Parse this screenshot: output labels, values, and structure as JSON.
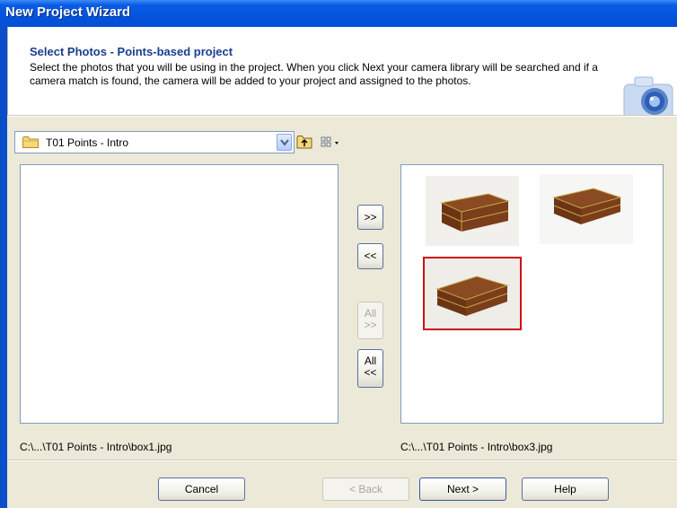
{
  "window": {
    "title": "New Project Wizard"
  },
  "header": {
    "title": "Select Photos - Points-based project",
    "description": "Select the photos that you will be using in the project. When you click Next your camera library will be searched and if a camera match is found, the camera will be added to your project and assigned to the photos.",
    "icon": "camera-icon"
  },
  "folder": {
    "selected": "T01 Points - Intro",
    "icon": "folder-icon"
  },
  "toolbar": {
    "up_icon": "up-folder-icon",
    "view_icon": "view-menu-icon"
  },
  "transfer": {
    "add_label": ">>",
    "remove_label": "<<",
    "add_all_label_1": "All",
    "add_all_label_2": ">>",
    "remove_all_label_1": "All",
    "remove_all_label_2": "<<"
  },
  "selected_photos": {
    "items": [
      {
        "name": "box-photo-1",
        "selected": false
      },
      {
        "name": "box-photo-2",
        "selected": false
      },
      {
        "name": "box-photo-3",
        "selected": true
      }
    ]
  },
  "paths": {
    "left": "C:\\...\\T01 Points - Intro\\box1.jpg",
    "right": "C:\\...\\T01 Points - Intro\\box3.jpg"
  },
  "footer": {
    "cancel": "Cancel",
    "back": "< Back",
    "next": "Next >",
    "help": "Help"
  },
  "colors": {
    "title_bar": "#0553dc",
    "selection_border": "#d10f0f",
    "dialog_bg": "#ece9d8"
  }
}
